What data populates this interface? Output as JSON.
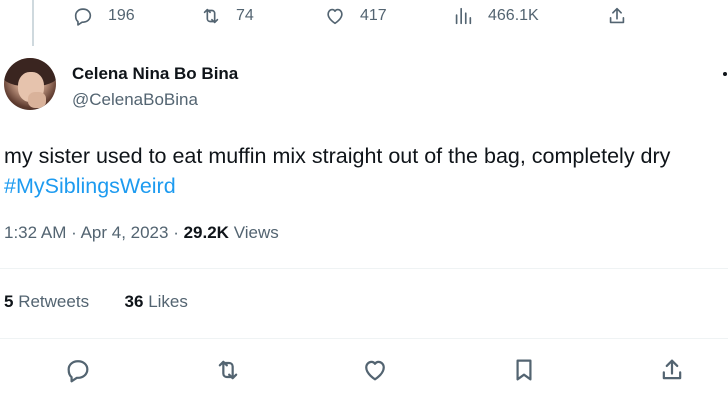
{
  "top_actions": {
    "replies": "196",
    "retweets": "74",
    "likes": "417",
    "views": "466.1K"
  },
  "tweet": {
    "author_name": "Celena Nina Bo Bina",
    "author_handle": "@CelenaBoBina",
    "text": "my sister used to eat muffin mix straight out of the bag, completely dry",
    "hashtag": "#MySiblingsWeird",
    "time": "1:32 AM",
    "date": "Apr 4, 2023",
    "views_count": "29.2K",
    "views_label": "Views"
  },
  "stats": {
    "retweets_count": "5",
    "retweets_label": "Retweets",
    "likes_count": "36",
    "likes_label": "Likes"
  },
  "colors": {
    "text_primary": "#0f1419",
    "text_secondary": "#536471",
    "link": "#1d9bf0",
    "divider": "#eff3f4"
  },
  "icons": {
    "reply": "reply-icon",
    "retweet": "retweet-icon",
    "like": "heart-icon",
    "views": "analytics-icon",
    "share": "share-icon",
    "bookmark": "bookmark-icon"
  }
}
